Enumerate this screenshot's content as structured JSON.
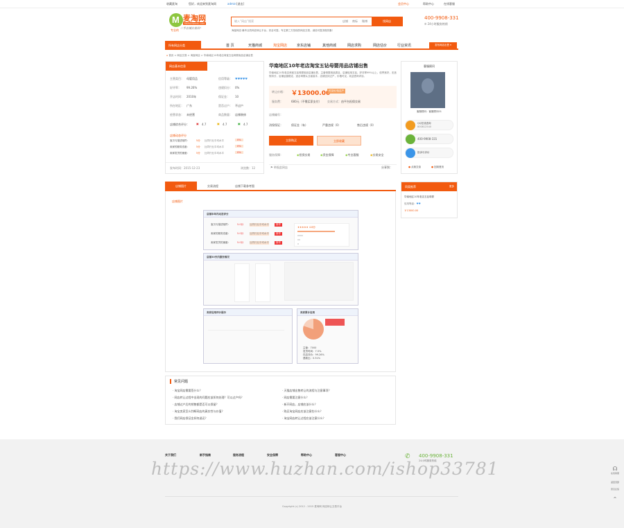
{
  "topbar": {
    "left_links": [
      "收藏麦淘",
      "您好，欢迎来到麦淘网",
      "admin",
      "[退出]"
    ],
    "right_links": [
      "会员中心",
      "帮助中心",
      "在线客服"
    ]
  },
  "header": {
    "logo_text": "麦淘网",
    "logo_sub": "MAITAOWANG.COM",
    "logo_slogan": "专业的",
    "logo_slogan2": "二手店铺交易网！",
    "search_placeholder": "输入“网店”搜索",
    "search_tabs": [
      "店铺",
      "商标",
      "微博"
    ],
    "search_button": "找网店",
    "search_hint": "海量网店·最专业的网店转让平台，安全可靠，专注第三方担保的网店交易，诚信可靠流程完备！",
    "phone": "400-9908-331",
    "phone_sub": "24小时服务热线"
  },
  "nav": {
    "category_label": "所有网店分类",
    "items": [
      "首 页",
      "天猫商城",
      "淘宝网店",
      "京东店铺",
      "其他商城",
      "网店求购",
      "网店估价",
      "行业资讯"
    ],
    "right_button": "发布网店出售 ▾"
  },
  "breadcrumb": [
    "首页",
    "网店交易",
    "淘宝网店",
    "华南地区10年老店淘宝五钻母婴用品店铺出售"
  ],
  "seller_panel": {
    "title": "网店基本信息",
    "rows": [
      [
        "主营类目：",
        "母婴用品",
        "信用等级：",
        "♥♥♥♥♥"
      ],
      [
        "好评率：",
        "99.26%",
        "违规扣分：",
        "0%"
      ],
      [
        "开店时间：",
        "2010年",
        "保证金：",
        "10"
      ],
      [
        "所在地区：",
        "广东",
        "是否过户：",
        "不过户"
      ],
      [
        "经营状态：",
        "未经营",
        "商品数量：",
        "店铺装修"
      ]
    ],
    "ratings_label": "店铺综合评分：",
    "ratings": [
      "4.7",
      "4.7",
      "4.7"
    ],
    "dsr_title": "店铺动态评分",
    "dsr": [
      [
        "宝贝与描述相符：",
        "5分",
        "比同行业平均水平",
        "0%"
      ],
      [
        "卖家的服务态度：",
        "5分",
        "比同行业平均水平",
        "0%"
      ],
      [
        "卖家发货的速度：",
        "5分",
        "比同行业平均水平",
        "0%"
      ]
    ],
    "publish_time": "发布时间：2015-12-23",
    "view_count": "浏览数：12"
  },
  "product": {
    "title": "华南地区10年老店淘宝五钻母婴用品店铺出售",
    "desc": "华南地区10年老店淘宝五钻母婴用品店铺出售，主营母婴用品类目，店铺信用五钻，好评率99%以上，信誉良好，无违规扣分，店铺运营稳定，适合母婴从业者接手，店铺支持过户，价格可议，欢迎咨询详谈。",
    "price_label": "转让价格：",
    "price": "￥13000.00",
    "price_tag": "可议价/包过户",
    "fee_label": "服务费：",
    "fee_value": "680元（不需买家支付）",
    "pay_label": "交易方式：",
    "pay_value": "由平台担保交易",
    "contact_label": "店铺编号：",
    "misc_rows": [
      "消保保证：",
      "保证金（有）",
      "严重违规（0）",
      "售后违规（0）"
    ],
    "buy_button": "立即购买",
    "fav_button": "立即收藏",
    "service_label": "服务保障：",
    "services": [
      "担保交易",
      "资金保障",
      "专业客服",
      "交易安全"
    ],
    "share_label": "分享到：",
    "report_label": "举报此网店"
  },
  "agent_panel": {
    "title": "客服顾问",
    "name": "客服顾问：客服顾问01",
    "qq_label": "QQ在线咨询",
    "qq_number": "800812540",
    "phone": "400-9908-331",
    "complaint": "投诉与评价",
    "bottom_links": [
      "点我交谈",
      "回到首页"
    ]
  },
  "tabs": {
    "items": [
      "店铺图片",
      "交易流程",
      "店铺下载参考图"
    ],
    "link": "店铺图片"
  },
  "shop_screenshot": {
    "section1_title": "店铺半年内动态评分",
    "rows1": [
      [
        "宝贝与描述相符：",
        "5.0分",
        "比同行业平均水平",
        "持平"
      ],
      [
        "卖家的服务态度：",
        "5.0分",
        "比同行业平均水平",
        "持平"
      ],
      [
        "卖家发货的速度：",
        "5.0分",
        "比同行业平均水平",
        "持平"
      ]
    ],
    "section2_title": "店铺30天内服务情况",
    "section3_title": "卖家信用评价展示",
    "section4_title": "卖家累计信用",
    "side_title": "店铺收藏",
    "dsr_right": "4.8分",
    "stat_rows": [
      "主营：7000",
      "发货时间：7.5%",
      "在店评价：99.26%",
      "退款比：0.51%"
    ]
  },
  "recommend": {
    "title": "同类推荐",
    "more": "更多",
    "item": "华南地区10年老店五钻母婴",
    "meta": "信用等级：",
    "price": "￥13000.00"
  },
  "faq": {
    "title": "常见问题",
    "left": [
      "· 淘宝网店需要签什么？",
      "· 网店转让过程中出现的问题应该如何处理？可以过户吗？",
      "· 店铺过户后的销售额是否可以保留？",
      "· 淘宝卖家怎么判断网店的真实性与价值？",
      "· 我们网店保证金如何退还？"
    ],
    "right": [
      "· 天猫店铺出售转让的流程与注意事项？",
      "· 网店需要注意什么？",
      "· 新开网店，店铺应该什么？",
      "· 购买淘宝网店应该注意些什么？",
      "· 淘宝网店转让过程应该注意什么？"
    ]
  },
  "footer": {
    "columns": [
      "关于我们",
      "新手指南",
      "服务流程",
      "安全保障",
      "帮助中心",
      "客服中心"
    ],
    "phone": "400-9908-331",
    "phone_sub": "24小时服务热线",
    "copyright": "Copyright (c) 2012 - 2015 麦淘网 网店转让交易平台",
    "watermark": "https://www.huzhan.com/ishop33781"
  },
  "side_tools": [
    "在线客服",
    "返回顶部",
    "意见反馈"
  ]
}
